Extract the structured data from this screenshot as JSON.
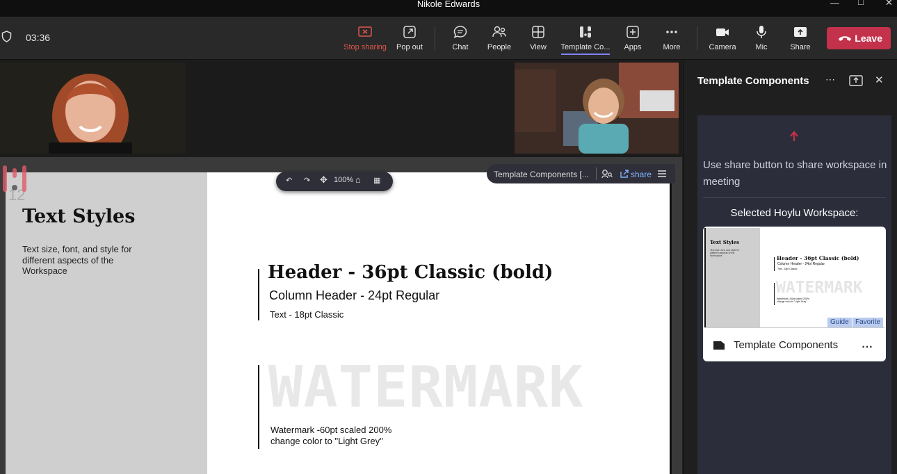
{
  "window": {
    "title": "Nikole Edwards"
  },
  "toolbar": {
    "timer": "03:36",
    "buttons": {
      "stop_sharing": "Stop sharing",
      "pop_out": "Pop out",
      "chat": "Chat",
      "people": "People",
      "view": "View",
      "template": "Template Co...",
      "apps": "Apps",
      "more": "More",
      "camera": "Camera",
      "mic": "Mic",
      "share": "Share"
    },
    "leave": "Leave"
  },
  "board": {
    "page_number": "12",
    "title": "Text Styles",
    "description": "Text size, font, and style for different aspects of the Workspace",
    "header_sample": "Header - 36pt Classic (bold)",
    "column_header_sample": "Column Header - 24pt Regular",
    "text_sample": "Text - 18pt Classic",
    "watermark": "WATERMARK",
    "watermark_note_1": "Watermark -60pt scaled 200%",
    "watermark_note_2": "change color to \"Light Grey\"",
    "zoom": "100%",
    "share_bar_name": "Template Components [...",
    "share_label": "share"
  },
  "panel": {
    "title": "Template Components",
    "help": "Use share button to share workspace in meeting",
    "selected_label": "Selected Hoylu Workspace:",
    "workspace_name": "Template Components",
    "tags": [
      "Guide",
      "Favorite"
    ],
    "thumb": {
      "title": "Text Styles",
      "desc": "Text size, font, and style for different aspects of the Workspace",
      "header": "Header - 36pt Classic (bold)",
      "column": "Column Header - 24pt Regular",
      "text": "Text - 18pt Classic",
      "watermark": "WATERMARK",
      "note": "Watermark -60pt scaled 200% change color to \"Light Grey\""
    }
  },
  "colors": {
    "leave": "#c4314b",
    "stop": "#e0564d",
    "accent": "#7f85f5",
    "arrow": "#c4314b"
  }
}
